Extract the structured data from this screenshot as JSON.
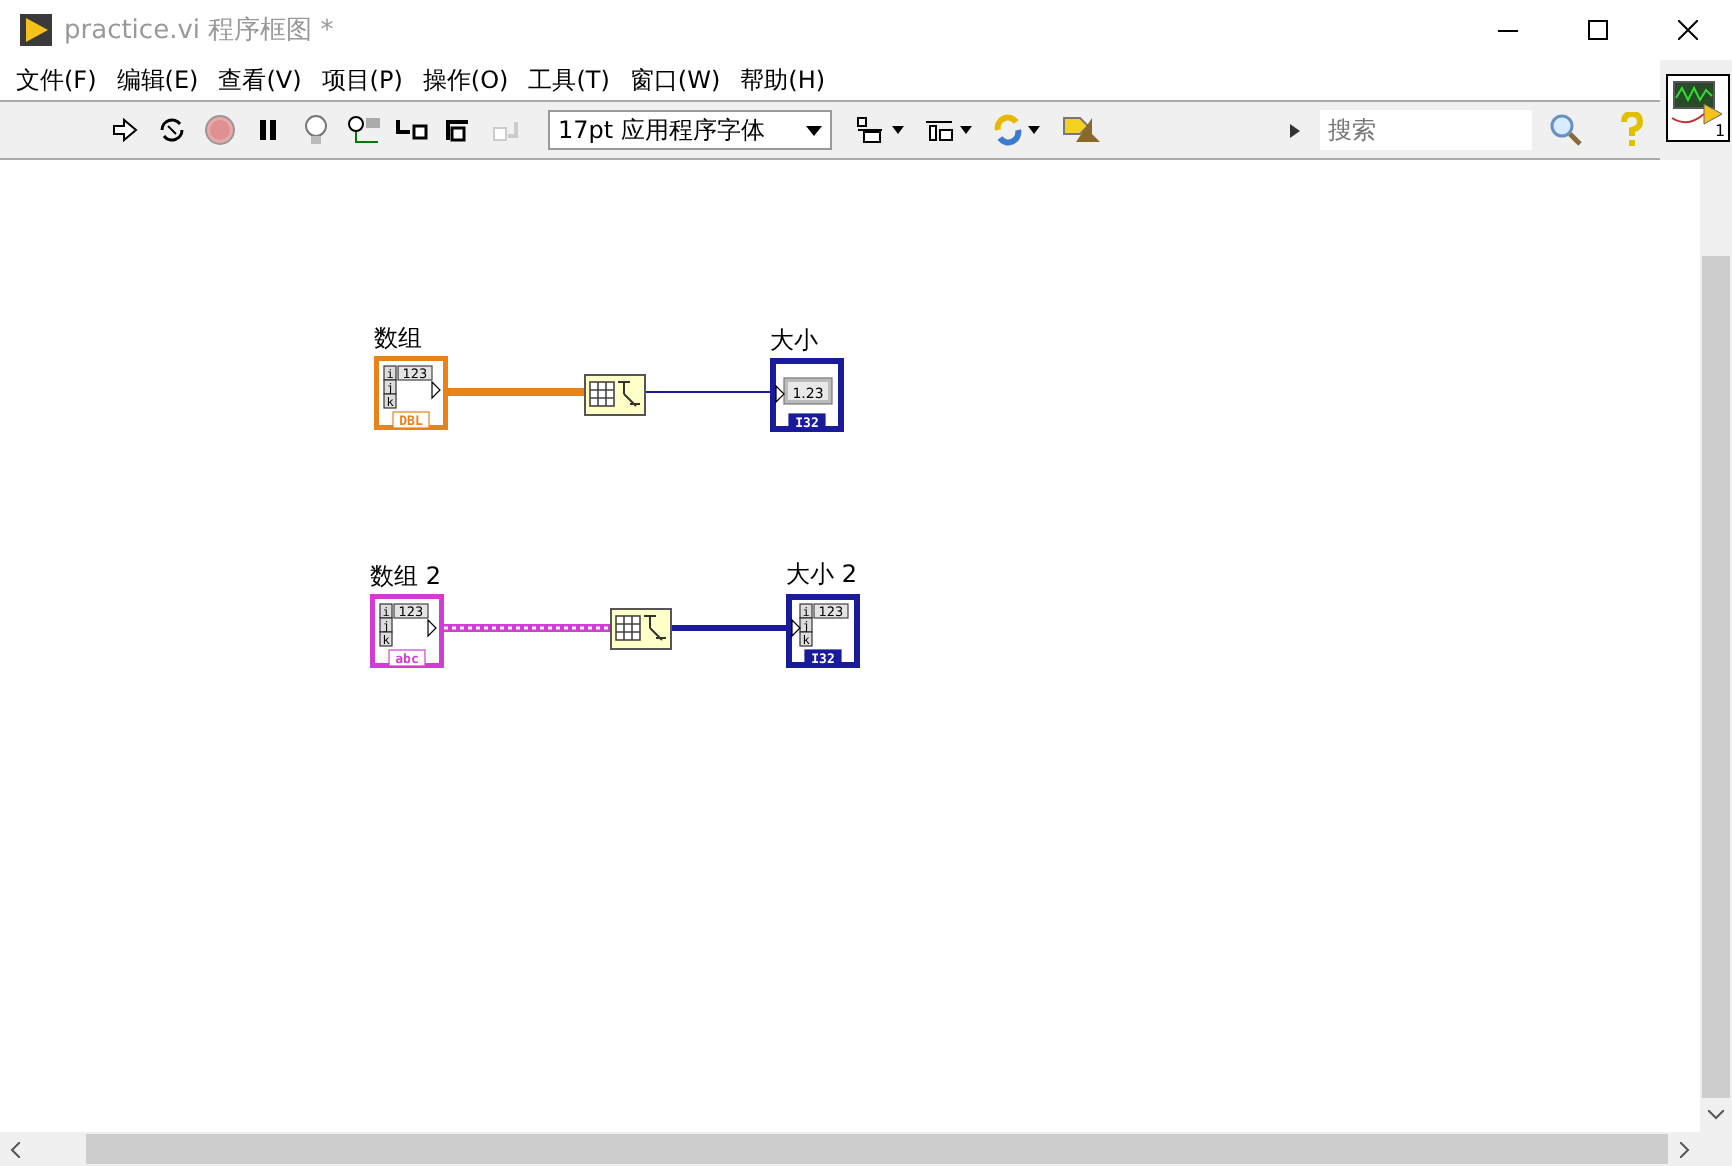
{
  "window": {
    "title": "practice.vi 程序框图 *"
  },
  "menu": [
    "文件(F)",
    "编辑(E)",
    "查看(V)",
    "项目(P)",
    "操作(O)",
    "工具(T)",
    "窗口(W)",
    "帮助(H)"
  ],
  "toolbar": {
    "font": "17pt 应用程序字体",
    "search": {
      "placeholder": "搜索"
    }
  },
  "vi_icon": {
    "number": "1"
  },
  "diagram": {
    "rows": [
      {
        "control": {
          "label": "数组",
          "kind": "array",
          "color": "#e8821a",
          "indices": [
            "i",
            "j",
            "k"
          ],
          "display": "123",
          "type": "DBL"
        },
        "function": {
          "kind": "array_size"
        },
        "indicator": {
          "label": "大小",
          "kind": "numeric",
          "display": "1.23",
          "type": "I32"
        }
      },
      {
        "control": {
          "label": "数组 2",
          "kind": "array",
          "color": "#d23cd2",
          "indices": [
            "i",
            "j",
            "k"
          ],
          "display": "123",
          "type": "abc"
        },
        "function": {
          "kind": "array_size"
        },
        "indicator": {
          "label": "大小 2",
          "kind": "array",
          "indices": [
            "i",
            "j",
            "k"
          ],
          "display": "123",
          "type": "I32"
        }
      }
    ]
  }
}
